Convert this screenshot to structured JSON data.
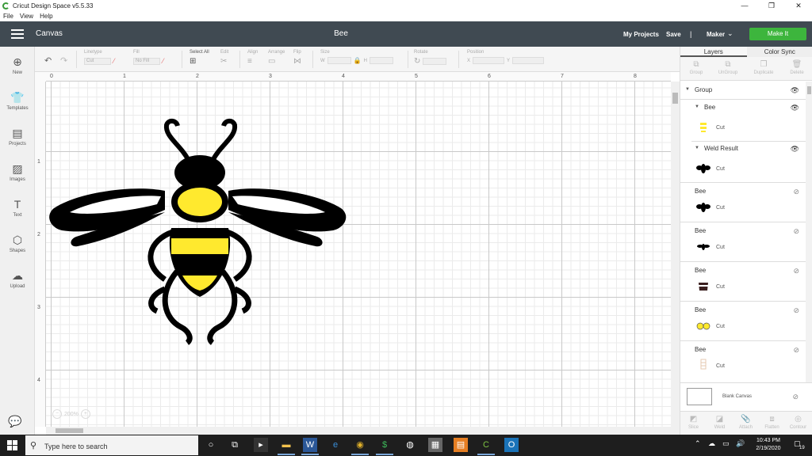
{
  "window": {
    "title": "Cricut Design Space  v5.5.33",
    "minimize": "—",
    "restore": "❐",
    "close": "✕"
  },
  "menu": [
    "File",
    "View",
    "Help"
  ],
  "header": {
    "section": "Canvas",
    "doc_title": "Bee",
    "my_projects": "My Projects",
    "save": "Save",
    "separator": "|",
    "machine": "Maker",
    "make_it": "Make It"
  },
  "toolbar": {
    "linetype_label": "Linetype",
    "linetype_value": "Cut",
    "fill_label": "Fill",
    "fill_value": "No Fill",
    "select_all": "Select All",
    "edit": "Edit",
    "align": "Align",
    "arrange": "Arrange",
    "flip": "Flip",
    "size": "Size",
    "w": "W",
    "h": "H",
    "rotate": "Rotate",
    "position": "Position",
    "x": "X",
    "y": "Y"
  },
  "sidebar": [
    {
      "label": "New",
      "icon": "⊕"
    },
    {
      "label": "Templates",
      "icon": "👕"
    },
    {
      "label": "Projects",
      "icon": "▤"
    },
    {
      "label": "Images",
      "icon": "▨"
    },
    {
      "label": "Text",
      "icon": "T"
    },
    {
      "label": "Shapes",
      "icon": "⬡"
    },
    {
      "label": "Upload",
      "icon": "☁"
    }
  ],
  "ruler": {
    "top": [
      "0",
      "1",
      "2",
      "3",
      "4",
      "5",
      "6",
      "7",
      "8"
    ],
    "left": [
      "1",
      "2",
      "3",
      "4"
    ]
  },
  "zoom": {
    "minus": "−",
    "value": "200%",
    "plus": "+"
  },
  "panel": {
    "tabs": [
      "Layers",
      "Color Sync"
    ],
    "actions": [
      "Group",
      "UnGroup",
      "Duplicate",
      "Delete"
    ],
    "bottom_actions": [
      "Slice",
      "Weld",
      "Attach",
      "Flatten",
      "Contour"
    ],
    "layers": [
      {
        "name": "Group",
        "type": "group"
      },
      {
        "name": "Bee",
        "type": "subgroup"
      },
      {
        "cut": "Cut",
        "thumb": "yellow-stripes"
      },
      {
        "name": "Weld Result",
        "type": "subgroup"
      },
      {
        "cut": "Cut",
        "thumb": "bee-black"
      },
      {
        "name": "Bee",
        "cut": "Cut",
        "thumb": "bee-black"
      },
      {
        "name": "Bee",
        "cut": "Cut",
        "thumb": "bee-small"
      },
      {
        "name": "Bee",
        "cut": "Cut",
        "thumb": "brown-body"
      },
      {
        "name": "Bee",
        "cut": "Cut",
        "thumb": "yellow-eyes"
      },
      {
        "name": "Bee",
        "cut": "Cut",
        "thumb": "outline-beige"
      }
    ],
    "blank_canvas": "Blank Canvas"
  },
  "taskbar": {
    "search_placeholder": "Type here to search",
    "time": "10:43 PM",
    "date": "2/19/2020",
    "notifications": "19"
  },
  "colors": {
    "header_bg": "#404a52",
    "make_it": "#3db53d",
    "bee_black": "#000000",
    "bee_yellow": "#ffe92e"
  }
}
